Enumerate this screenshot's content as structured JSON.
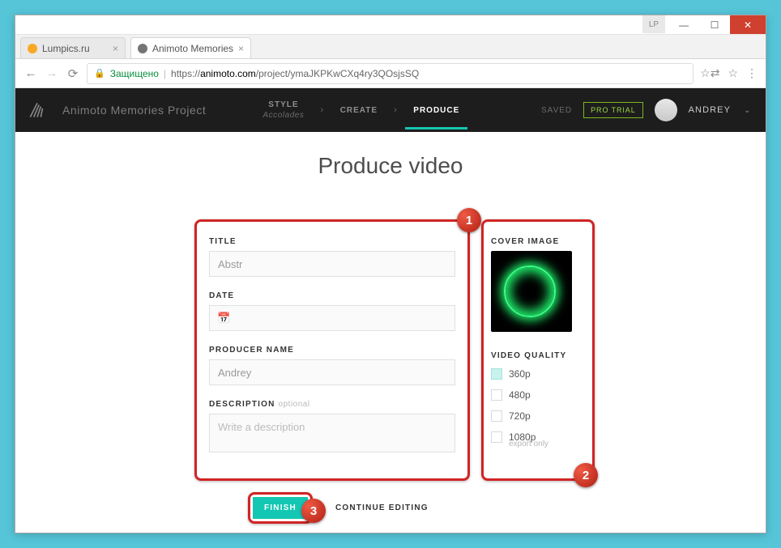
{
  "browser": {
    "tabs": [
      {
        "title": "Lumpics.ru"
      },
      {
        "title": "Animoto Memories"
      }
    ],
    "secure_label": "Защищено",
    "url_prefix": "https://",
    "url_host": "animoto.com",
    "url_path": "/project/ymaJKPKwCXq4ry3QOsjsSQ",
    "lp_badge": "LP"
  },
  "header": {
    "project": "Animoto Memories Project",
    "steps": [
      {
        "label": "STYLE",
        "sub": "Accolades"
      },
      {
        "label": "CREATE"
      },
      {
        "label": "PRODUCE"
      }
    ],
    "saved": "SAVED",
    "pro_trial": "PRO TRIAL",
    "user": "ANDREY"
  },
  "page": {
    "title": "Produce video"
  },
  "form": {
    "title_label": "TITLE",
    "title_value": "Abstr",
    "date_label": "DATE",
    "date_value": "",
    "producer_label": "PRODUCER NAME",
    "producer_value": "Andrey",
    "description_label": "DESCRIPTION",
    "description_optional": "optional",
    "description_placeholder": "Write a description"
  },
  "sidebar": {
    "cover_label": "COVER IMAGE",
    "quality_label": "VIDEO QUALITY",
    "options": [
      {
        "label": "360p"
      },
      {
        "label": "480p"
      },
      {
        "label": "720p"
      },
      {
        "label": "1080p",
        "sub": "export only"
      }
    ]
  },
  "buttons": {
    "finish": "FINISH",
    "continue": "CONTINUE EDITING"
  },
  "annotations": {
    "n1": "1",
    "n2": "2",
    "n3": "3"
  }
}
